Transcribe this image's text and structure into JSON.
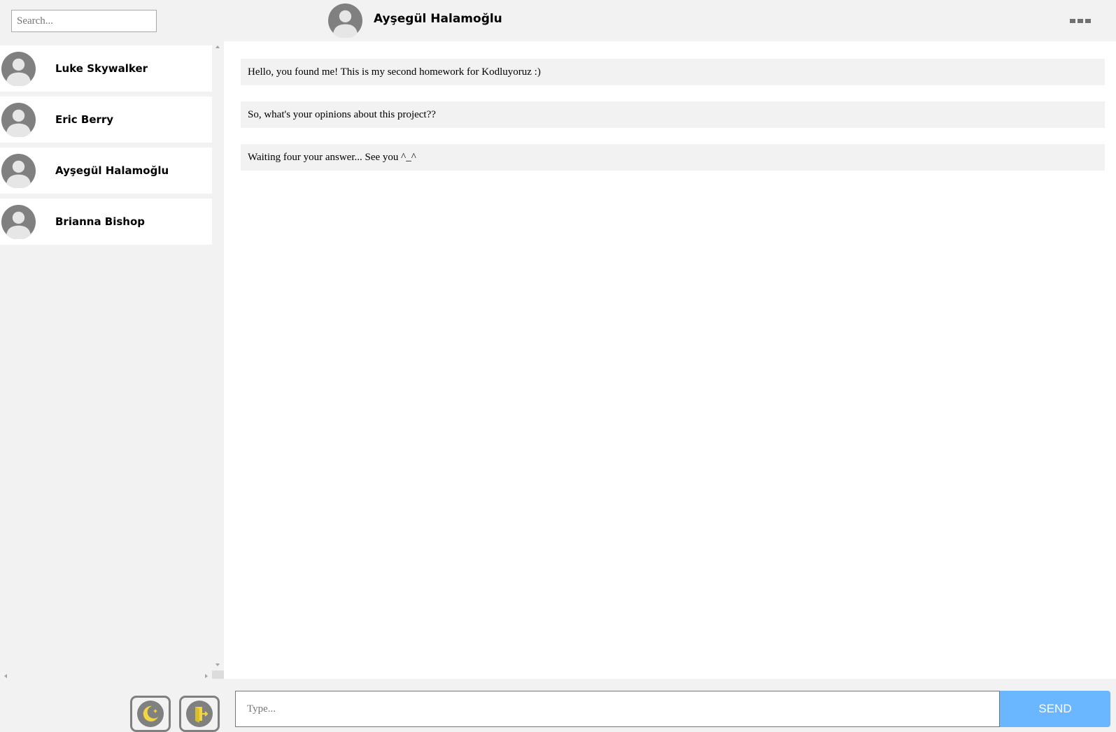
{
  "search": {
    "placeholder": "Search..."
  },
  "header": {
    "active_contact": "Ayşegül Halamoğlu"
  },
  "contacts": [
    {
      "name": "Luke Skywalker"
    },
    {
      "name": "Eric Berry"
    },
    {
      "name": "Ayşegül Halamoğlu"
    },
    {
      "name": "Brianna Bishop"
    }
  ],
  "messages": [
    {
      "text": "Hello, you found me! This is my second homework for Kodluyoruz :)"
    },
    {
      "text": "So, what's your opinions about this project??"
    },
    {
      "text": "Waiting four your answer... See you ^_^"
    }
  ],
  "composer": {
    "placeholder": "Type...",
    "send_label": "SEND"
  },
  "icons": {
    "theme_toggle": "moon-icon",
    "logout": "exit-door-icon",
    "menu": "more-options-icon",
    "avatar": "user-avatar-icon"
  },
  "colors": {
    "send_button": "#6ab7ff",
    "background": "#f2f2f2",
    "icon_yellow": "#f2d541"
  }
}
